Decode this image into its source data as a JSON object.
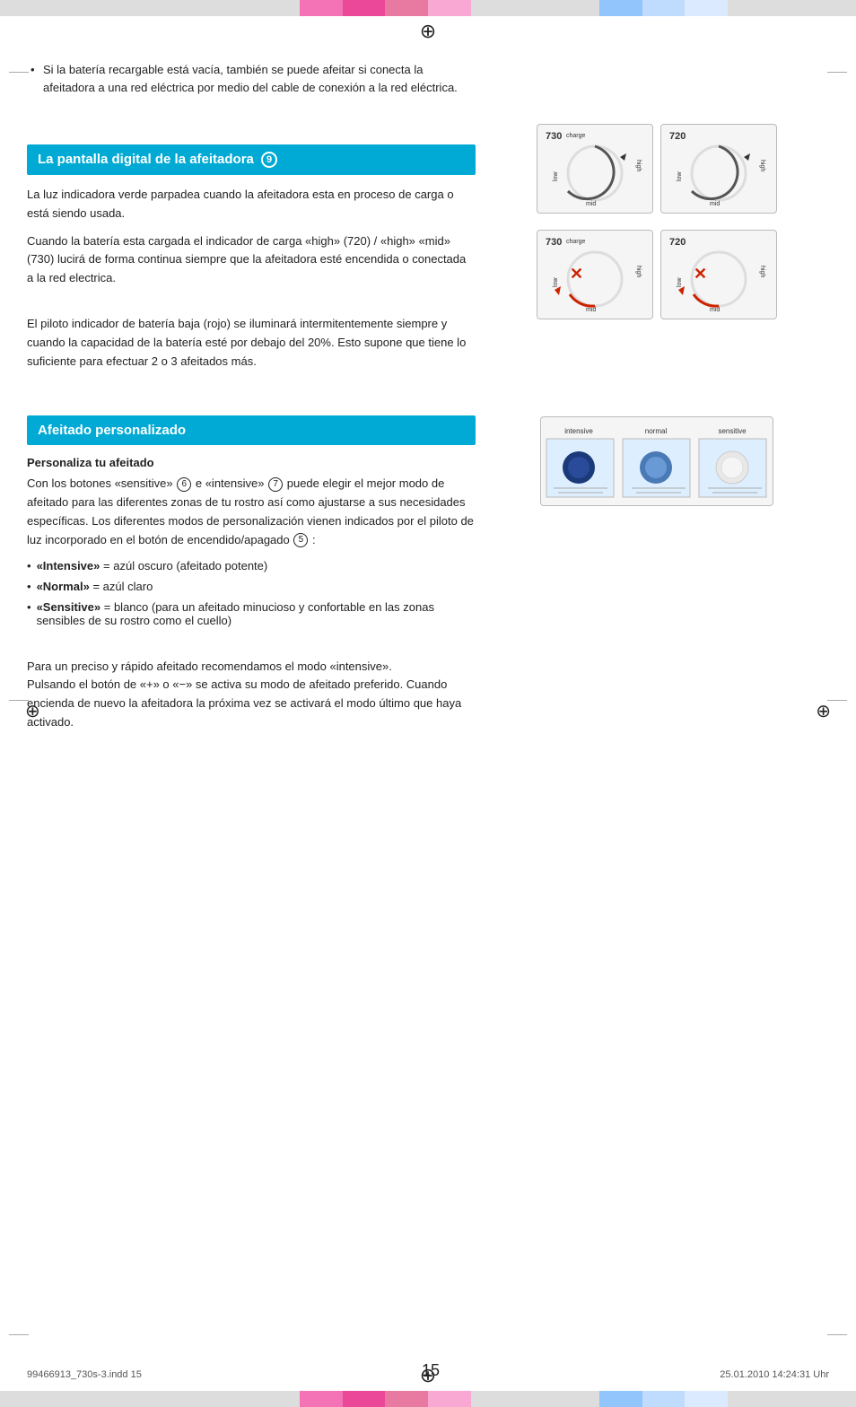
{
  "colorBar": {
    "colors": [
      "#e8e8e8",
      "#e8e8e8",
      "#e8e8e8",
      "#e8e8e8",
      "#e8e8e8",
      "#e8e8e8",
      "#e8e8e8",
      "#f472b6",
      "#ec4899",
      "#e879a0",
      "#f9a8d4",
      "#e8e8e8",
      "#e8e8e8",
      "#e8e8e8",
      "#e8e8e8",
      "#93c5fd",
      "#bfdbfe",
      "#dbeafe",
      "#e8e8e8",
      "#e8e8e8",
      "#e8e8e8",
      "#e8e8e8",
      "#e8e8e8",
      "#e8e8e8",
      "#e8e8e8",
      "#e8e8e8"
    ]
  },
  "topBullet": "Si la batería recargable está vacía, también se puede afeitar si conecta la afeitadora a una red eléctrica por medio del cable de conexión a la red eléctrica.",
  "section1": {
    "heading": "La pantalla digital de la afeitadora",
    "circle_num": "9",
    "para1": "La luz indicadora verde parpadea cuando la afeitadora esta en proceso de carga o está siendo usada.",
    "para2": "Cuando la batería esta cargada el indicador de carga «high» (720) / «high» «mid» (730) lucirá de forma continua siempre que la afeitadora esté encendida o conectada a la red electrica.",
    "para3": "El piloto indicador de batería baja (rojo) se iluminará intermitentemente siempre y cuando la capacidad de la batería esté por debajo del 20%. Esto supone que tiene lo suficiente para efectuar 2 o 3 afeitados más."
  },
  "section2": {
    "heading": "Afeitado personalizado",
    "subheading": "Personaliza tu afeitado",
    "para1_prefix": "Con los botones «sensitive»",
    "circle6": "6",
    "para1_mid": " e «intensive»",
    "circle7": "7",
    "para1_suffix": " puede elegir el mejor modo de afeitado para las diferentes zonas de tu rostro así como ajustarse a sus necesidades específicas. Los diferentes modos de personalización vienen indicados por el piloto de luz incorporado en el botón de encendido/apagado",
    "circle5": "5",
    "para1_end": ":",
    "bullets": [
      {
        "label": "«Intensive»",
        "eq": "=",
        "value": "azúl oscuro (afeitado potente)"
      },
      {
        "label": "«Normal»",
        "eq": "=",
        "value": "azúl claro"
      },
      {
        "label": "«Sensitive»",
        "eq": "=",
        "value": "blanco (para un afeitado minucioso y confortable en las zonas sensibles de su rostro como el cuello)"
      }
    ],
    "para2": "Para un preciso y rápido afeitado recomendamos el modo «intensive».\nPulsando el botón de «+» o «−» se activa su modo de afeitado preferido. Cuando encienda de nuevo la afeitadora la próxima vez se activará el modo último que haya activado."
  },
  "diagrams": {
    "row1_left_num": "730",
    "row1_left_label": "charge",
    "row1_right_num": "720",
    "row2_left_num": "730",
    "row2_left_label": "charge",
    "row2_right_num": "720"
  },
  "modeLabels": {
    "intensive": "intensive",
    "normal": "normal",
    "sensitive": "sensitive"
  },
  "footer": {
    "file_info": "99466913_730s-3.indd   15",
    "page": "15",
    "date": "25.01.2010   14:24:31 Uhr"
  }
}
